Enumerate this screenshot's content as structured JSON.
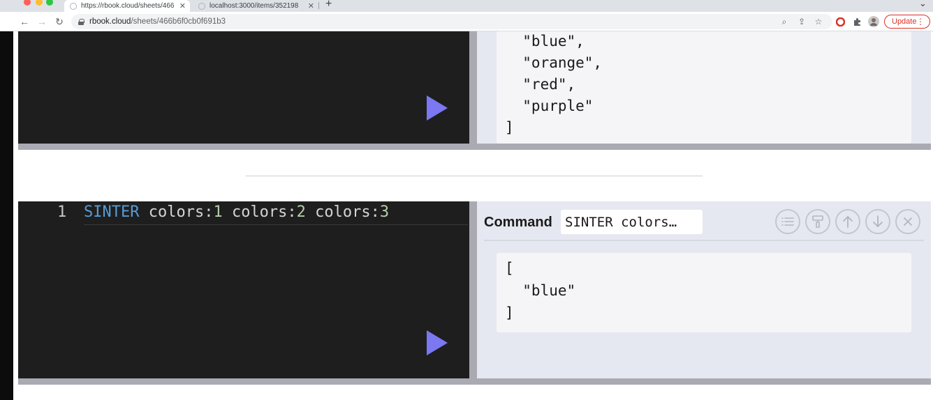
{
  "browser": {
    "tabs": [
      {
        "title": "https://rbook.cloud/sheets/466",
        "active": true
      },
      {
        "title": "localhost:3000/items/352198",
        "active": false
      }
    ],
    "new_tab": "+",
    "tab_strip_menu": "⌄",
    "address": {
      "host": "rbook.cloud",
      "path": "/sheets/466b6f0cb0f691b3"
    },
    "update_label": "Update"
  },
  "cells": [
    {
      "output_lines": [
        "  \"blue\",",
        "  \"orange\",",
        "  \"red\",",
        "  \"purple\"",
        "]"
      ]
    },
    {
      "line_number": "1",
      "code": {
        "keyword": "SINTER",
        "t1": " colors:",
        "n1": "1",
        "t2": " colors:",
        "n2": "2",
        "t3": " colors:",
        "n3": "3"
      },
      "header": {
        "label": "Command",
        "command_preview": "SINTER colors…"
      },
      "output_lines": [
        "[",
        "  \"blue\"",
        "]"
      ]
    }
  ],
  "colors": {
    "editor_bg": "#1e1e1e",
    "output_bg": "#e6e8f1",
    "run_button": "#7b78f2",
    "keyword": "#569cd6",
    "number": "#b5cea8"
  }
}
